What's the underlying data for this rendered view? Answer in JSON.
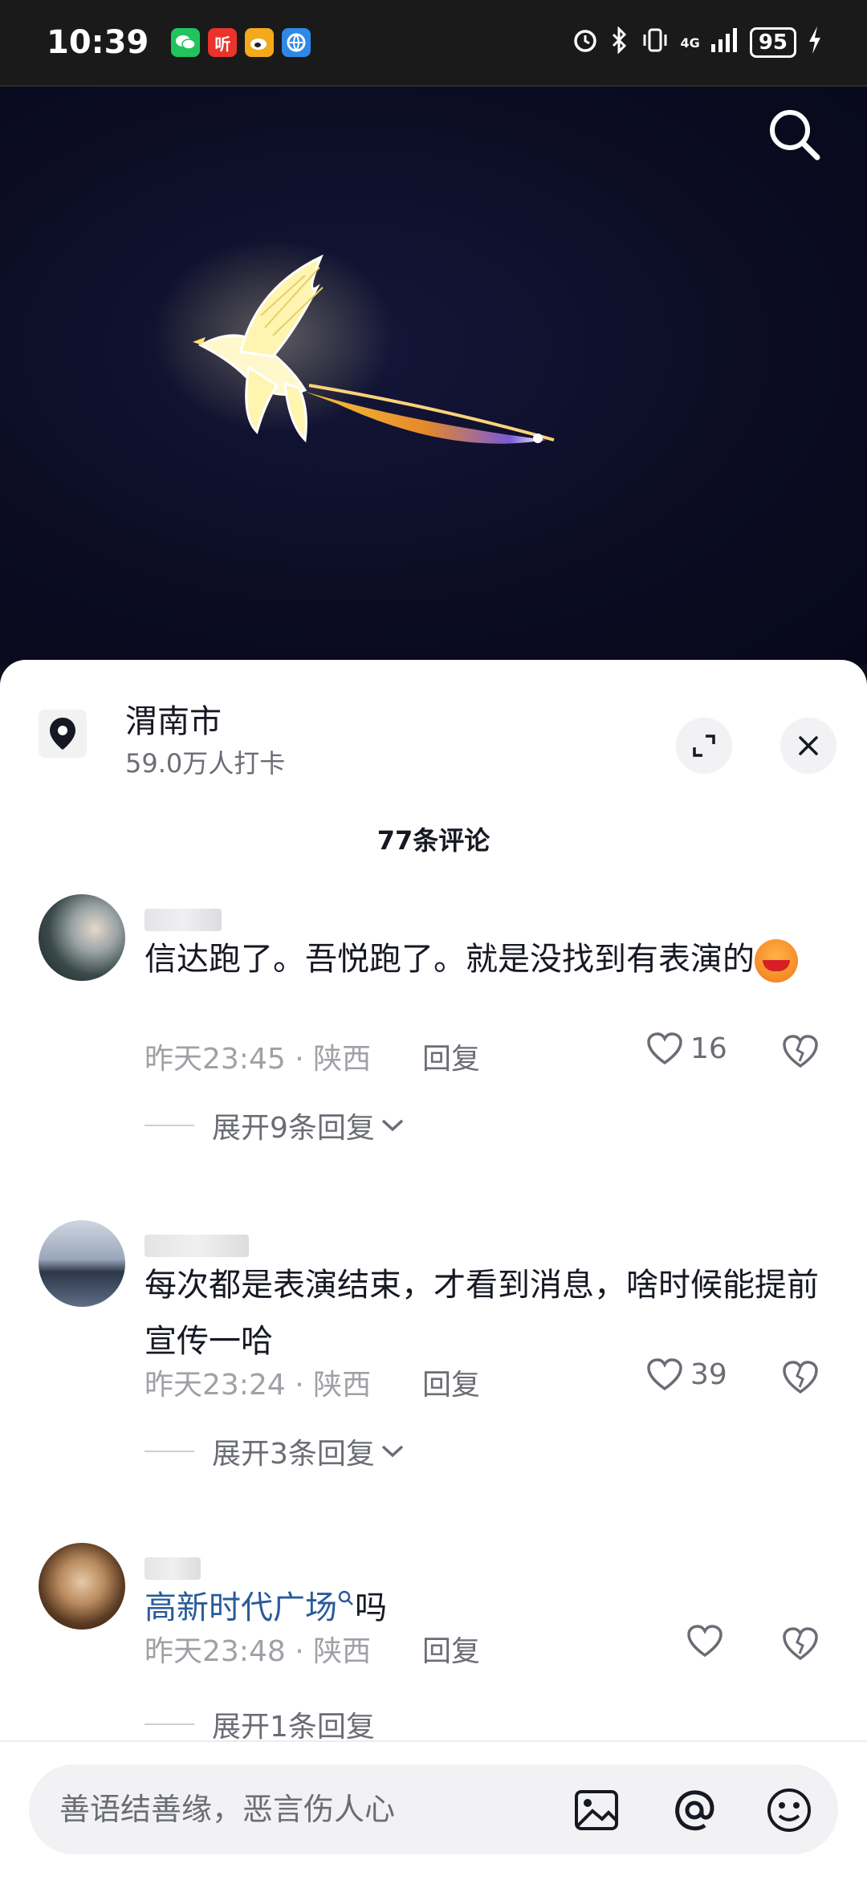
{
  "status_bar": {
    "time": "10:39",
    "apps": [
      {
        "icon": "wechat-icon",
        "color": "#22c35d"
      },
      {
        "icon": "ting-icon",
        "label": "听",
        "color": "#e9332b"
      },
      {
        "icon": "weibo-icon",
        "color": "#f3a91c"
      },
      {
        "icon": "browser-icon",
        "color": "#2f88e6"
      }
    ],
    "network": "4G",
    "battery": "95"
  },
  "video": {
    "search_icon": "search-icon"
  },
  "location": {
    "title": "渭南市",
    "subtitle": "59.0万人打卡"
  },
  "comments_header": "77条评论",
  "comments": [
    {
      "text": "信达跑了。吾悦跑了。就是没找到有表演的",
      "time": "昨天23:45",
      "region": "陕西",
      "reply_label": "回复",
      "likes": "16",
      "expand_label": "展开9条回复"
    },
    {
      "text": "每次都是表演结束，才看到消息，啥时候能提前宣传一哈",
      "time": "昨天23:24",
      "region": "陕西",
      "reply_label": "回复",
      "likes": "39",
      "expand_label": "展开3条回复"
    },
    {
      "link_text": "高新时代广场",
      "text_suffix": "吗",
      "time": "昨天23:48",
      "region": "陕西",
      "reply_label": "回复",
      "likes": "",
      "expand_label": "展开1条回复"
    }
  ],
  "meta_separator": "·",
  "input": {
    "placeholder": "善语结善缘，恶言伤人心",
    "icons": [
      "image-icon",
      "at-icon",
      "emoji-icon"
    ]
  },
  "colors": {
    "link": "#2a5b9a",
    "accent_like": "#6b6d75"
  }
}
